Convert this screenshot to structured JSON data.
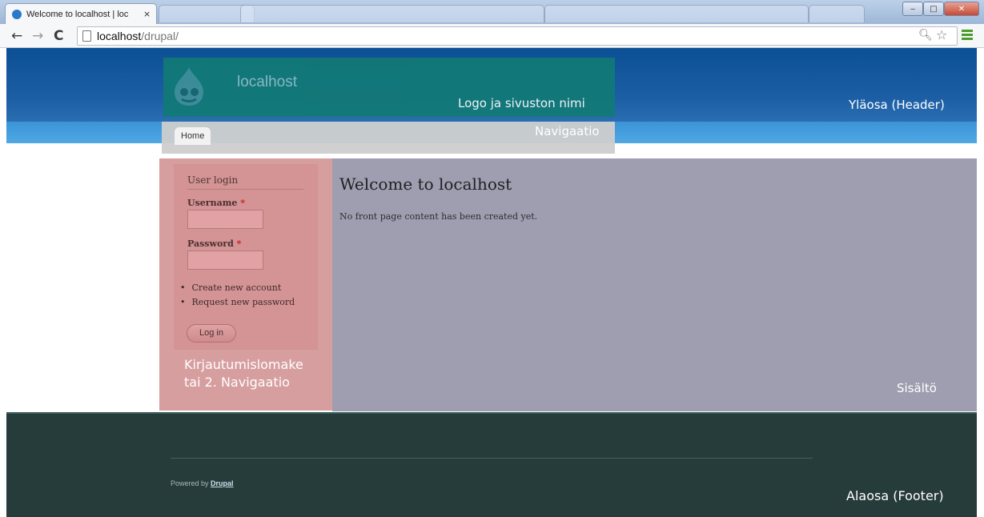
{
  "browser": {
    "tab_title": "Welcome to localhost | loc",
    "tab_close": "×",
    "url_host": "localhost",
    "url_path": "/drupal/"
  },
  "site": {
    "name": "localhost",
    "nav_home": "Home"
  },
  "overlay_labels": {
    "logo": "Logo ja sivuston nimi",
    "header": "Yläosa (Header)",
    "navigation": "Navigaatio",
    "sidebar_line1": "Kirjautumislomake",
    "sidebar_line2": "tai 2. Navigaatio",
    "content": "Sisältö",
    "footer": "Alaosa (Footer)"
  },
  "login": {
    "title": "User login",
    "username_label": "Username",
    "password_label": "Password",
    "required_mark": "*",
    "links": [
      "Create new account",
      "Request new password"
    ],
    "button": "Log in"
  },
  "content": {
    "title": "Welcome to localhost",
    "text": "No front page content has been created yet."
  },
  "footer": {
    "powered_prefix": "Powered by ",
    "powered_link": "Drupal"
  },
  "colors": {
    "header": "#0b4f95",
    "logo_region": "#127a76",
    "nav_bar": "#3b94d7",
    "sidebar_region": "#d79e9f",
    "content_region": "#9e9eb0",
    "footer": "#263c3b"
  }
}
